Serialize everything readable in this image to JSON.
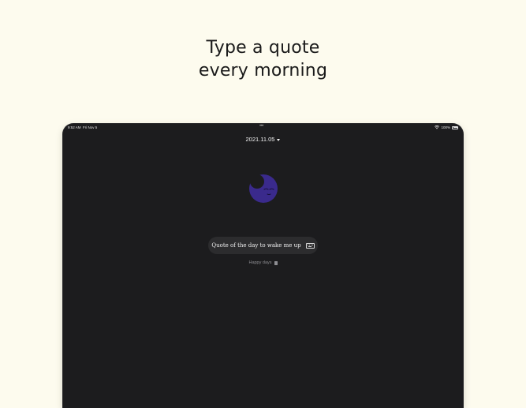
{
  "headline": {
    "line1": "Type a quote",
    "line2": "every morning"
  },
  "status_bar": {
    "time": "9:52 AM",
    "date": "Fri Nov 5",
    "multitask": "•••",
    "battery": "100%"
  },
  "date_selector": {
    "label": "2021.11.05"
  },
  "quote_field": {
    "placeholder": "Quote of the day to wake me up"
  },
  "caption": {
    "text": "Happy days"
  },
  "icons": {
    "moon": "moon-icon",
    "keyboard": "keyboard-icon",
    "caret": "caret-down-icon",
    "book": "book-icon"
  },
  "colors": {
    "background": "#fdfbee",
    "device": "#1c1c1e",
    "moon": "#3a2a8c",
    "pill": "#2c2c2e"
  }
}
